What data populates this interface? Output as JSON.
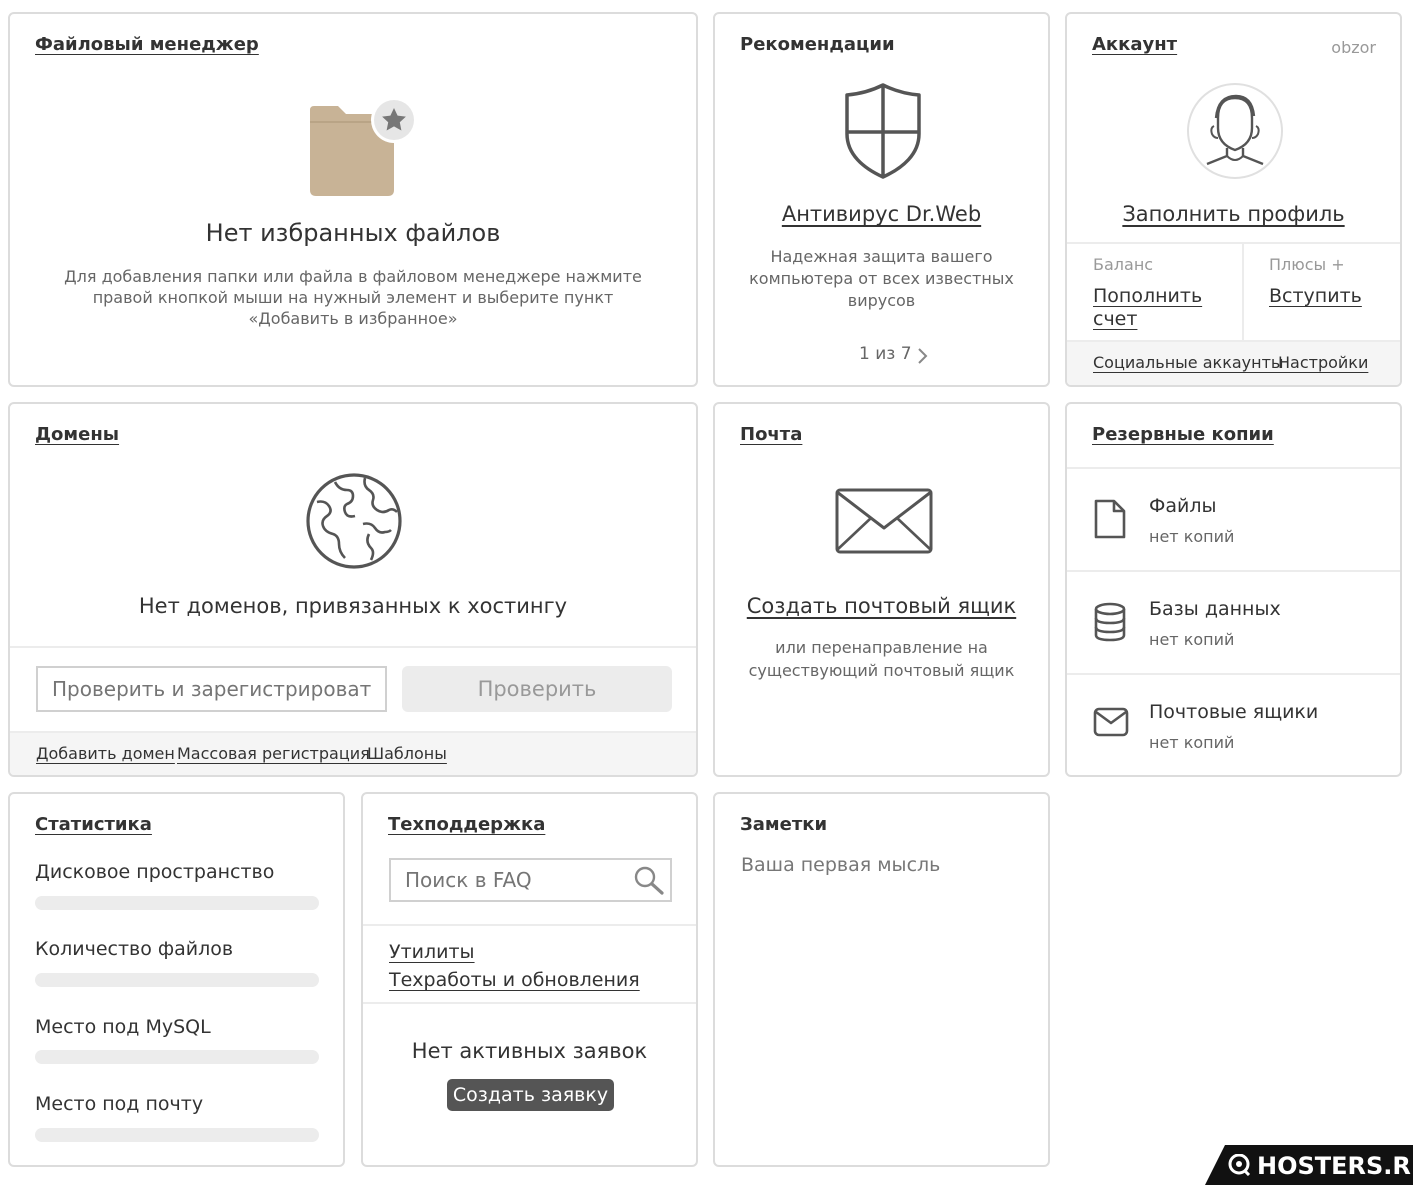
{
  "file_manager": {
    "title": "Файловый менеджер",
    "empty_title": "Нет избранных файлов",
    "empty_text_1": "Для добавления папки или файла в файловом менеджере нажмите",
    "empty_text_2": "правой кнопкой мыши на нужный элемент и выберите пункт",
    "empty_text_3": "«Добавить в избранное»",
    "icon": "folder-star-icon"
  },
  "recommendations": {
    "title": "Рекомендации",
    "item_title": "Антивирус Dr.Web",
    "item_text_1": "Надежная защита вашего",
    "item_text_2": "компьютера от всех известных",
    "item_text_3": "вирусов",
    "pager": "1 из 7",
    "icon": "shield-icon"
  },
  "account": {
    "title": "Аккаунт",
    "username": "obzor",
    "fill_profile": "Заполнить профиль",
    "balance_label": "Баланс",
    "balance_link_1": "Пополнить",
    "balance_link_2": "счет",
    "plus_label": "Плюсы +",
    "plus_link": "Вступить",
    "social": "Социальные аккаунты",
    "settings": "Настройки",
    "icon": "user-avatar-icon"
  },
  "domains": {
    "title": "Домены",
    "empty_title": "Нет доменов, привязанных к хостингу",
    "input_placeholder": "Проверить и зарегистрировать",
    "check_button": "Проверить",
    "add_domain": "Добавить домен",
    "mass_registration": "Массовая регистрация",
    "templates": "Шаблоны",
    "icon": "globe-icon"
  },
  "mail": {
    "title": "Почта",
    "create_link": "Создать почтовый ящик",
    "text_1": "или перенаправление на",
    "text_2": "существующий почтовый ящик",
    "icon": "envelope-icon"
  },
  "backups": {
    "title": "Резервные копии",
    "items": [
      {
        "name": "Файлы",
        "status": "нет копий",
        "icon": "file-icon"
      },
      {
        "name": "Базы данных",
        "status": "нет копий",
        "icon": "database-icon"
      },
      {
        "name": "Почтовые ящики",
        "status": "нет копий",
        "icon": "mail-icon"
      }
    ]
  },
  "statistics": {
    "title": "Статистика",
    "items": [
      {
        "label": "Дисковое пространство",
        "fill": 0
      },
      {
        "label": "Количество файлов",
        "fill": 0
      },
      {
        "label": "Место под MySQL",
        "fill": 0
      },
      {
        "label": "Место под почту",
        "fill": 0
      }
    ]
  },
  "support": {
    "title": "Техподдержка",
    "search_placeholder": "Поиск в FAQ",
    "link_utilities": "Утилиты",
    "link_maintenance": "Техработы и обновления",
    "no_tickets": "Нет активных заявок",
    "create_ticket": "Создать заявку"
  },
  "notes": {
    "title": "Заметки",
    "placeholder": "Ваша первая мысль"
  },
  "watermark": "HOSTERS.RU"
}
